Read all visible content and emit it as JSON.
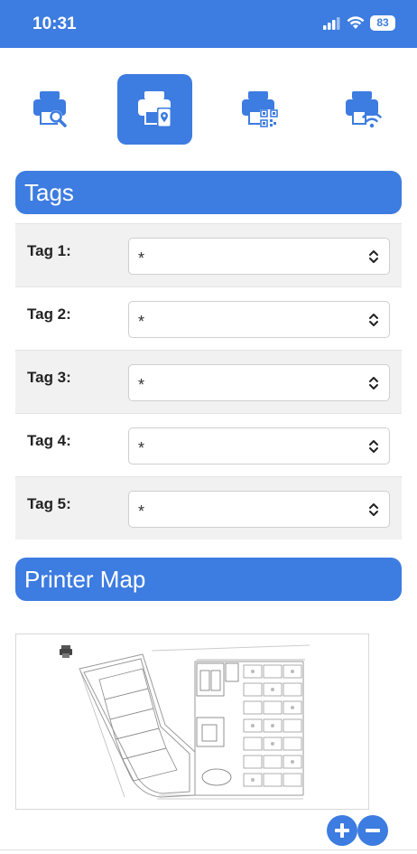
{
  "status": {
    "time": "10:31",
    "battery": "83"
  },
  "toolbar": {
    "buttons": [
      {
        "name": "search-printer"
      },
      {
        "name": "location-printer",
        "active": true
      },
      {
        "name": "qr-printer"
      },
      {
        "name": "wifi-printer"
      }
    ]
  },
  "tags": {
    "title": "Tags",
    "rows": [
      {
        "label": "Tag 1:",
        "value": "*"
      },
      {
        "label": "Tag 2:",
        "value": "*"
      },
      {
        "label": "Tag 3:",
        "value": "*"
      },
      {
        "label": "Tag 4:",
        "value": "*"
      },
      {
        "label": "Tag 5:",
        "value": "*"
      }
    ]
  },
  "map": {
    "title": "Printer Map"
  },
  "colors": {
    "accent": "#3d7ce0",
    "shaded_row": "#f1f1f1"
  }
}
